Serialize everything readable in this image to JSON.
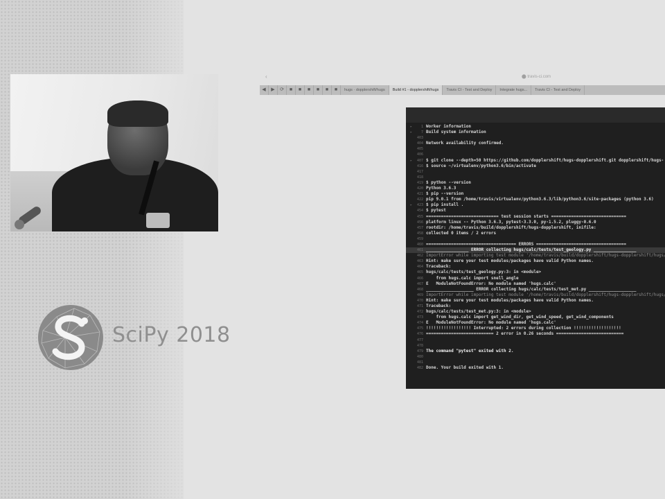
{
  "slide": {
    "logo_text": "SciPy 2018"
  },
  "browser": {
    "nav_glyph": "‹",
    "url_text": "⬤ travis-ci.com",
    "tabs": [
      {
        "label": "◀",
        "icon": true
      },
      {
        "label": "▶",
        "icon": true
      },
      {
        "label": "⟳",
        "icon": true
      },
      {
        "label": "■",
        "icon": true
      },
      {
        "label": "■",
        "icon": true
      },
      {
        "label": "■",
        "icon": true
      },
      {
        "label": "■",
        "icon": true
      },
      {
        "label": "■",
        "icon": true
      },
      {
        "label": "■",
        "icon": true
      },
      {
        "label": "hugs · dopplershift/hugs",
        "icon": false
      },
      {
        "label": "Build #1 - dopplershift/hugs",
        "icon": false,
        "active": true
      },
      {
        "label": "Travis CI - Test and Deploy",
        "icon": false
      },
      {
        "label": "Integrate hugs...",
        "icon": false
      },
      {
        "label": "Travis CI - Test and Deploy",
        "icon": false
      }
    ]
  },
  "terminal": {
    "lines": [
      {
        "n": "1",
        "t": "Worker information",
        "arrow": "▸"
      },
      {
        "n": "7",
        "t": "Build system information",
        "arrow": "▸"
      },
      {
        "n": "403",
        "t": ""
      },
      {
        "n": "404",
        "t": "Network availability confirmed."
      },
      {
        "n": "405",
        "t": ""
      },
      {
        "n": "406",
        "t": ""
      },
      {
        "n": "407",
        "t": "$ git clone --depth=50 https://github.com/dopplershift/hugs-dopplershift.git dopplershift/hugs-",
        "arrow": "▸"
      },
      {
        "n": "416",
        "t": "$ source ~/virtualenv/python3.6/bin/activate"
      },
      {
        "n": "417",
        "t": ""
      },
      {
        "n": "418",
        "t": ""
      },
      {
        "n": "419",
        "t": "$ python --version"
      },
      {
        "n": "420",
        "t": "Python 3.6.3"
      },
      {
        "n": "421",
        "t": "$ pip --version"
      },
      {
        "n": "422",
        "t": "pip 9.0.1 from /home/travis/virtualenv/python3.6.3/lib/python3.6/site-packages (python 3.6)"
      },
      {
        "n": "423",
        "t": "$ pip install .",
        "arrow": "▸"
      },
      {
        "n": "454",
        "t": "$ pytest"
      },
      {
        "n": "455",
        "t": "============================= test session starts =============================="
      },
      {
        "n": "456",
        "t": "platform linux -- Python 3.6.3, pytest-3.3.0, py-1.5.2, pluggy-0.6.0"
      },
      {
        "n": "457",
        "t": "rootdir: /home/travis/build/dopplershift/hugs-dopplershift, inifile:"
      },
      {
        "n": "458",
        "t": "collected 0 items / 2 errors"
      },
      {
        "n": "459",
        "t": ""
      },
      {
        "n": "460",
        "t": "==================================== ERRORS ===================================="
      },
      {
        "n": "461",
        "t": "_________________ ERROR collecting hugs/calc/tests/test_geology.py _________________",
        "kind": "err"
      },
      {
        "n": "462",
        "t": "ImportError while importing test module '/home/travis/build/dopplershift/hugs-dopplershift/hugs/calc/te",
        "kind": "dim"
      },
      {
        "n": "463",
        "t": "Hint: make sure your test modules/packages have valid Python names."
      },
      {
        "n": "464",
        "t": "Traceback:"
      },
      {
        "n": "465",
        "t": "hugs/calc/tests/test_geology.py:3: in <module>"
      },
      {
        "n": "466",
        "t": "    from hugs.calc import snell_angle"
      },
      {
        "n": "467",
        "t": "E   ModuleNotFoundError: No module named 'hugs.calc'"
      },
      {
        "n": "468",
        "t": "___________________ ERROR collecting hugs/calc/tests/test_met.py ___________________"
      },
      {
        "n": "469",
        "t": "ImportError while importing test module '/home/travis/build/dopplershift/hugs-dopplershift/hugs/calc/te",
        "kind": "dim"
      },
      {
        "n": "470",
        "t": "Hint: make sure your test modules/packages have valid Python names."
      },
      {
        "n": "471",
        "t": "Traceback:"
      },
      {
        "n": "472",
        "t": "hugs/calc/tests/test_met.py:3: in <module>"
      },
      {
        "n": "473",
        "t": "    from hugs.calc import get_wind_dir, get_wind_speed, get_wind_components"
      },
      {
        "n": "474",
        "t": "E   ModuleNotFoundError: No module named 'hugs.calc'"
      },
      {
        "n": "475",
        "t": "!!!!!!!!!!!!!!!!!! Interrupted: 2 errors during collection !!!!!!!!!!!!!!!!!!!"
      },
      {
        "n": "476",
        "t": "=========================== 2 error in 0.26 seconds ==========================="
      },
      {
        "n": "477",
        "t": ""
      },
      {
        "n": "478",
        "t": ""
      },
      {
        "n": "479",
        "t": "The command \"pytest\" exited with 2.",
        "kind": "title"
      },
      {
        "n": "480",
        "t": ""
      },
      {
        "n": "481",
        "t": ""
      },
      {
        "n": "482",
        "t": "Done. Your build exited with 1."
      }
    ]
  }
}
